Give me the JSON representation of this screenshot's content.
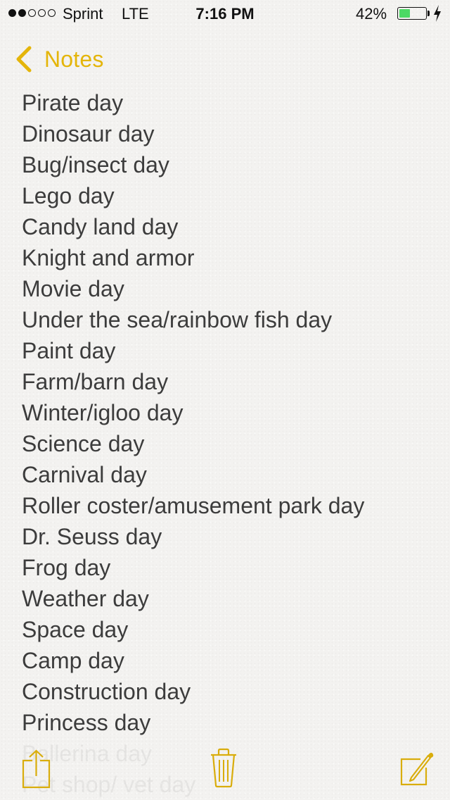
{
  "status_bar": {
    "signal_bars_total": 5,
    "signal_bars_filled": 2,
    "carrier": "Sprint",
    "network": "LTE",
    "time": "7:16 PM",
    "battery_percent_label": "42%",
    "battery_level": 0.42,
    "charging": true,
    "battery_color": "#4cd964"
  },
  "nav": {
    "back_label": "Notes",
    "accent_color": "#e4b50a"
  },
  "note": {
    "lines": [
      "Pirate day",
      "Dinosaur day",
      "Bug/insect day",
      "Lego day",
      "Candy land day",
      "Knight and armor",
      "Movie day",
      "Under the sea/rainbow fish day",
      "Paint day",
      "Farm/barn day",
      "Winter/igloo day",
      "Science day",
      "Carnival day",
      "Roller coster/amusement park day",
      "Dr. Seuss day",
      "Frog day",
      "Weather day",
      "Space day",
      "Camp day",
      "Construction day",
      "Princess day",
      "Ballerina day",
      "Pet shop/ vet day"
    ]
  },
  "toolbar": {
    "icons": [
      "share-icon",
      "trash-icon",
      "compose-icon"
    ]
  }
}
